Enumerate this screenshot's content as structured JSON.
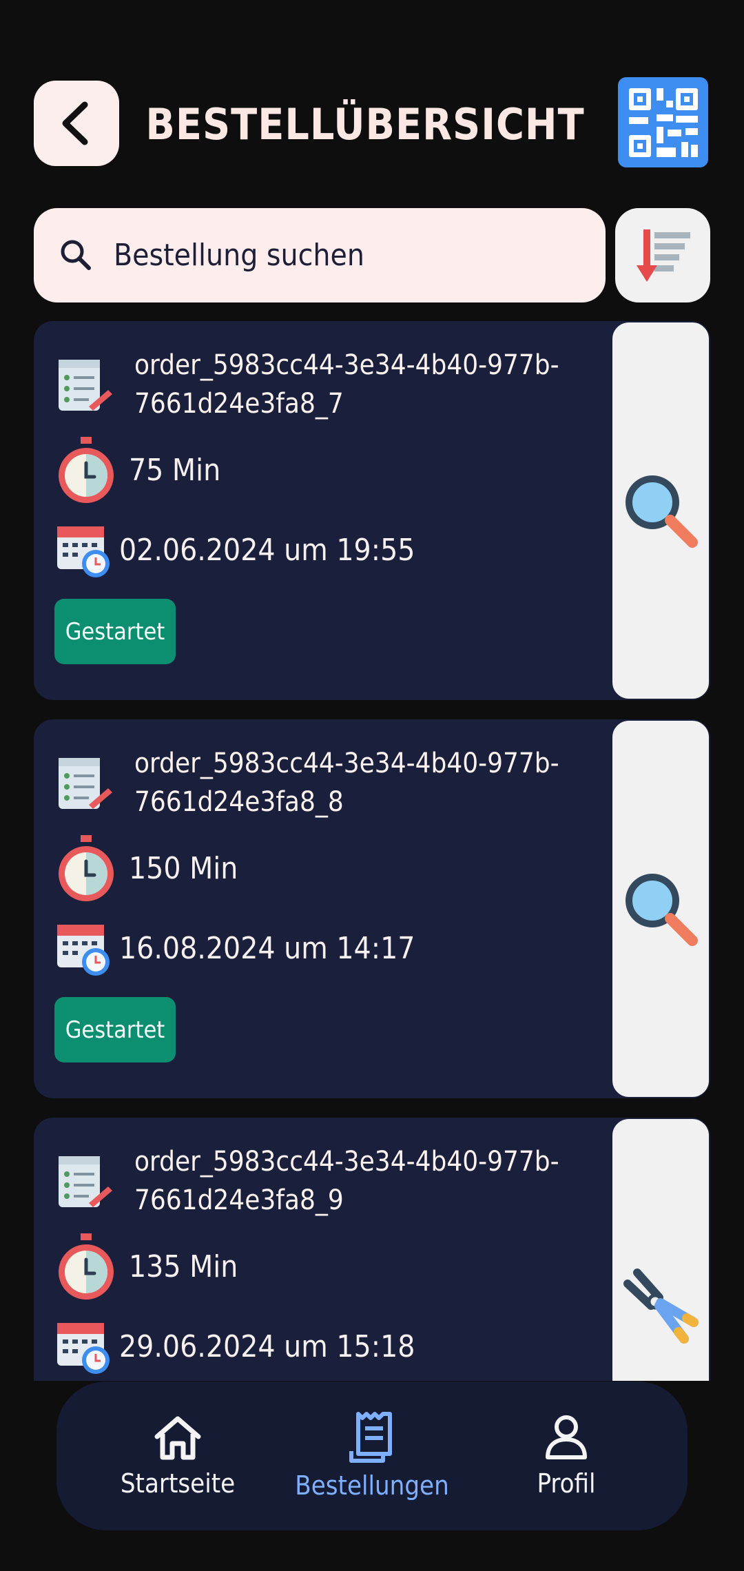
{
  "header": {
    "title": "BESTELLÜBERSICHT"
  },
  "search": {
    "placeholder": "Bestellung suchen"
  },
  "orders": [
    {
      "id": "order_5983cc44-3e34-4b40-977b-7661d24e3fa8_7",
      "duration": "75 Min",
      "datetime": "02.06.2024 um 19:55",
      "status": "Gestartet",
      "side_icon": "magnifier-icon"
    },
    {
      "id": "order_5983cc44-3e34-4b40-977b-7661d24e3fa8_8",
      "duration": "150 Min",
      "datetime": "16.08.2024 um 14:17",
      "status": "Gestartet",
      "side_icon": "magnifier-icon"
    },
    {
      "id": "order_5983cc44-3e34-4b40-977b-7661d24e3fa8_9",
      "duration": "135 Min",
      "datetime": "29.06.2024 um 15:18",
      "side_icon": "pliers-icon"
    }
  ],
  "nav": {
    "home": "Startseite",
    "orders": "Bestellungen",
    "profile": "Profil",
    "active_color": "#7fb0ff",
    "inactive_color": "#f4f4f4"
  }
}
